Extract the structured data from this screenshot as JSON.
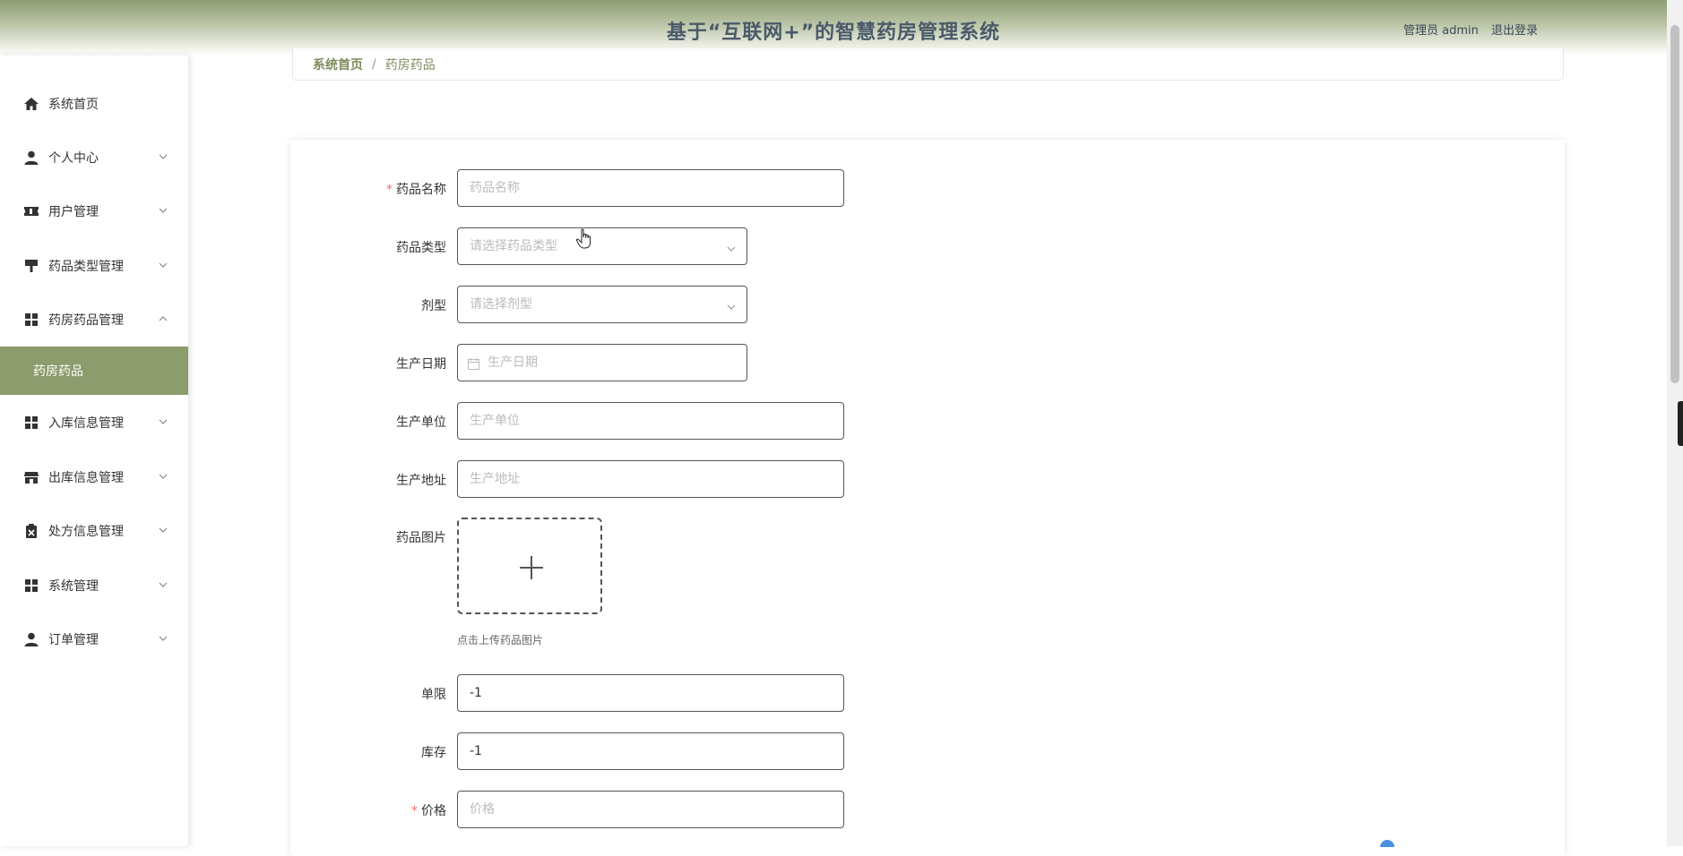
{
  "header": {
    "title": "基于“互联网+”的智慧药房管理系统",
    "user_label": "管理员 admin",
    "logout_label": "退出登录"
  },
  "sidebar": {
    "items": [
      {
        "label": "系统首页",
        "icon": "home-icon",
        "expandable": false
      },
      {
        "label": "个人中心",
        "icon": "user-icon",
        "expandable": true
      },
      {
        "label": "用户管理",
        "icon": "ticket-icon",
        "expandable": true
      },
      {
        "label": "药品类型管理",
        "icon": "brush-icon",
        "expandable": true
      },
      {
        "label": "药房药品管理",
        "icon": "grid-icon",
        "expandable": true,
        "expanded": true
      },
      {
        "label": "入库信息管理",
        "icon": "grid-icon",
        "expandable": true
      },
      {
        "label": "出库信息管理",
        "icon": "shop-icon",
        "expandable": true
      },
      {
        "label": "处方信息管理",
        "icon": "clipboard-icon",
        "expandable": true
      },
      {
        "label": "系统管理",
        "icon": "grid-icon",
        "expandable": true
      },
      {
        "label": "订单管理",
        "icon": "user-icon",
        "expandable": true
      }
    ],
    "active_submenu": "药房药品"
  },
  "breadcrumb": {
    "home": "系统首页",
    "separator": "/",
    "current": "药房药品"
  },
  "form": {
    "name": {
      "label": "药品名称",
      "required": true,
      "placeholder": "药品名称",
      "value": ""
    },
    "type": {
      "label": "药品类型",
      "required": false,
      "placeholder": "请选择药品类型",
      "value": ""
    },
    "dosage": {
      "label": "剂型",
      "required": false,
      "placeholder": "请选择剂型",
      "value": ""
    },
    "production_date": {
      "label": "生产日期",
      "required": false,
      "placeholder": "生产日期",
      "value": ""
    },
    "manufacturer": {
      "label": "生产单位",
      "required": false,
      "placeholder": "生产单位",
      "value": ""
    },
    "address": {
      "label": "生产地址",
      "required": false,
      "placeholder": "生产地址",
      "value": ""
    },
    "image": {
      "label": "药品图片",
      "tip": "点击上传药品图片"
    },
    "limit": {
      "label": "单限",
      "required": false,
      "placeholder": "",
      "value": "-1"
    },
    "stock": {
      "label": "库存",
      "required": false,
      "placeholder": "",
      "value": "-1"
    },
    "price": {
      "label": "价格",
      "required": true,
      "placeholder": "价格",
      "value": ""
    },
    "required_mark": "*"
  },
  "colors": {
    "accent": "#8c9c6c",
    "required": "#f56c6c",
    "header_top": "#8c9c72"
  }
}
